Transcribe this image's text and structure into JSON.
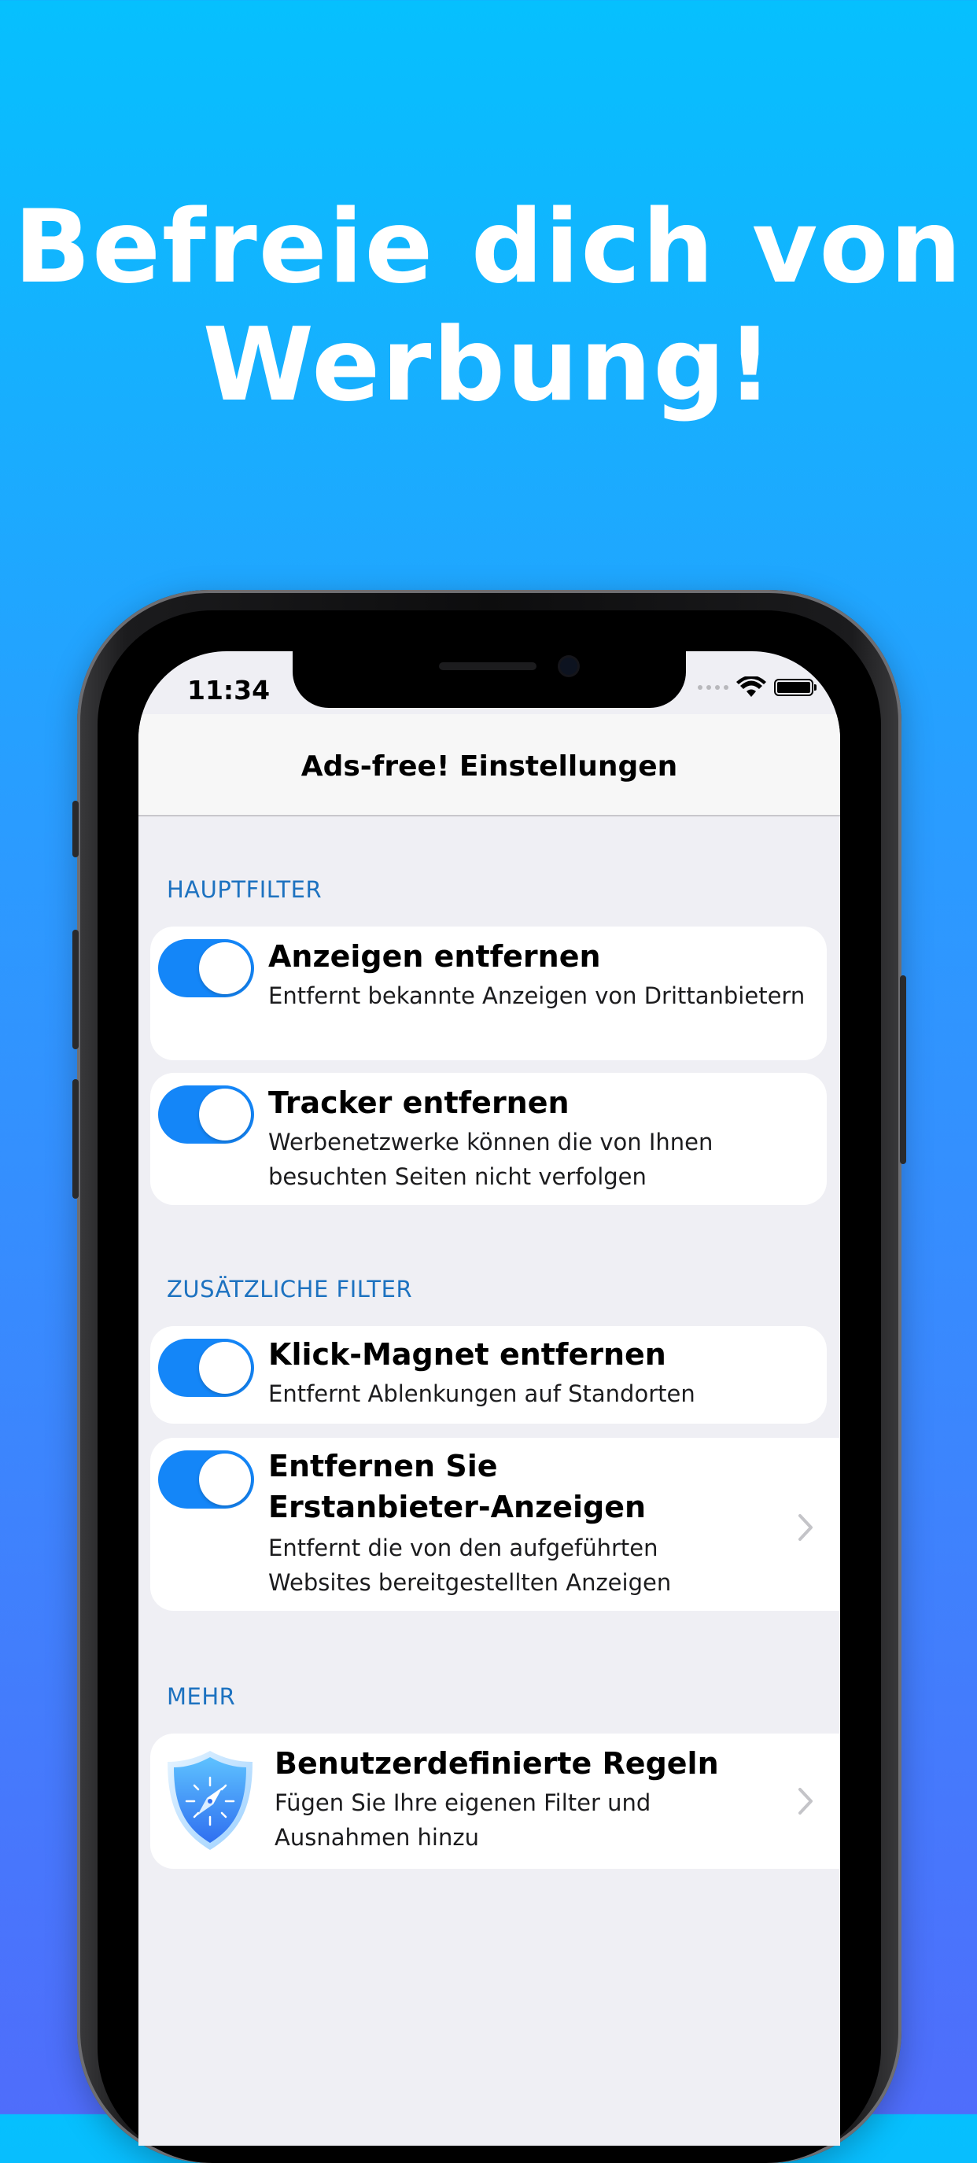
{
  "headline": {
    "line1": "Befreie dich von",
    "line2": "Werbung!"
  },
  "status_bar": {
    "time": "11:34",
    "icons": [
      "signal-dots-icon",
      "wifi-icon",
      "battery-icon"
    ]
  },
  "nav": {
    "title": "Ads-free! Einstellungen"
  },
  "sections": [
    {
      "header": "HAUPTFILTER",
      "items": [
        {
          "title": "Anzeigen entfernen",
          "subtitle_lines": [
            "Entfernt bekannte Anzeigen von Drittanbietern"
          ],
          "toggle_on": true
        },
        {
          "title": "Tracker entfernen",
          "subtitle_lines": [
            "Werbenetzwerke können die von Ihnen",
            "besuchten Seiten nicht verfolgen"
          ],
          "toggle_on": true
        }
      ]
    },
    {
      "header": "ZUSÄTZLICHE FILTER",
      "items": [
        {
          "title": "Klick-Magnet entfernen",
          "subtitle_lines": [
            "Entfernt Ablenkungen auf Standorten"
          ],
          "toggle_on": true
        },
        {
          "title_lines": [
            "Entfernen Sie",
            "Erstanbieter-Anzeigen"
          ],
          "subtitle_lines": [
            "Entfernt die von den aufgeführten",
            "Websites bereitgestellten Anzeigen"
          ],
          "toggle_on": true,
          "has_chevron": true
        }
      ]
    },
    {
      "header": "MEHR",
      "items": [
        {
          "title": "Benutzerdefinierte Regeln",
          "subtitle_lines": [
            "Fügen Sie Ihre eigenen Filter und",
            "Ausnahmen hinzu"
          ],
          "icon": "shield-compass-icon",
          "has_chevron": true
        }
      ]
    }
  ],
  "colors": {
    "background_top": "#06c0fe",
    "background_bottom": "#4f6dfb",
    "toggle_on": "#1486f8",
    "section_header": "#1d72c0",
    "table_background": "#efeff4"
  }
}
